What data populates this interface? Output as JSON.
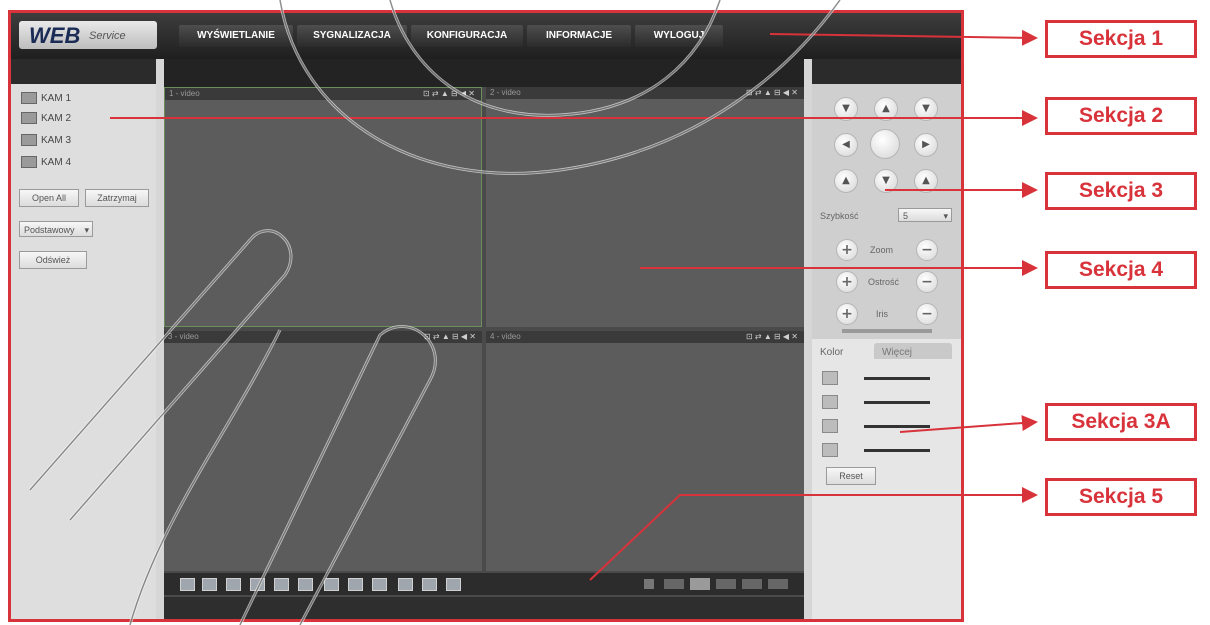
{
  "app": {
    "logo_main": "WEB",
    "logo_sub": "Service",
    "menu": [
      "WYŚWIETLANIE",
      "SYGNALIZACJA",
      "KONFIGURACJA",
      "INFORMACJE",
      "WYLOGUJ"
    ]
  },
  "left_panel": {
    "cameras": [
      "KAM 1",
      "KAM 2",
      "KAM 3",
      "KAM 4"
    ],
    "open_all": "Open All",
    "close_all": "Zatrzymaj",
    "stream_select": "Podstawowy",
    "refresh": "Odśwież"
  },
  "video": {
    "tile_labels": [
      "1 - video",
      "2 - video",
      "3 - video",
      "4 - video"
    ],
    "tile_controls": "⊡ ⇄ ▲ ⊟ ◀ ✕"
  },
  "ptz": {
    "speed_label": "Szybkość",
    "speed_value": "5",
    "zoom_label": "Zoom",
    "focus_label": "Ostrość",
    "iris_label": "Iris",
    "plus": "+",
    "minus": "−",
    "arrows": [
      "▼",
      "▲",
      "▼",
      "◀",
      "",
      "▶",
      "▲",
      "▼",
      "▲"
    ]
  },
  "color": {
    "tab_color": "Kolor",
    "tab_more": "Więcej",
    "reset": "Reset"
  },
  "callouts": [
    "Sekcja 1",
    "Sekcja 2",
    "Sekcja 3",
    "Sekcja 4",
    "Sekcja 3A",
    "Sekcja 5"
  ]
}
